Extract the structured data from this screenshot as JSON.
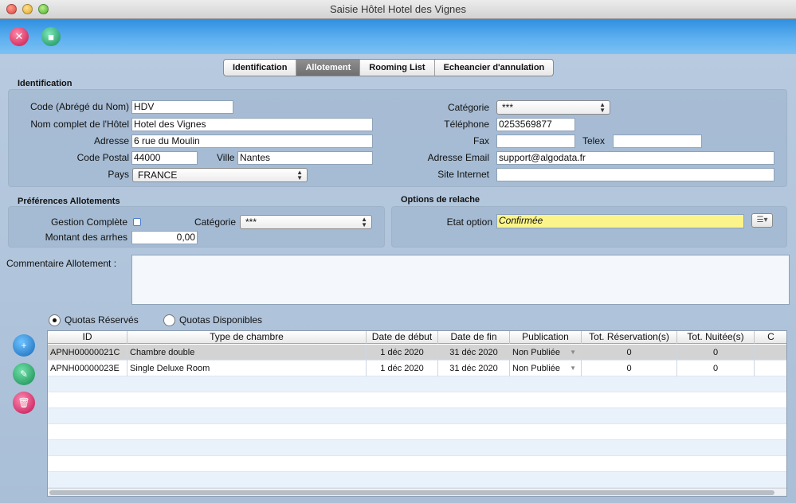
{
  "window": {
    "title": "Saisie Hôtel Hotel des Vignes"
  },
  "toolbar": {
    "close_icon": "close-doc-icon",
    "save_icon": "save-icon"
  },
  "tabs": [
    {
      "label": "Identification"
    },
    {
      "label": "Allotement",
      "active": true
    },
    {
      "label": "Rooming List"
    },
    {
      "label": "Echeancier d'annulation"
    }
  ],
  "identification": {
    "title": "Identification",
    "code_label": "Code  (Abrégé du Nom)",
    "code_value": "HDV",
    "nom_label": "Nom complet de l'Hôtel",
    "nom_value": "Hotel des Vignes",
    "adresse_label": "Adresse",
    "adresse_value": "6 rue du Moulin",
    "cp_label": "Code Postal",
    "cp_value": "44000",
    "ville_label": "Ville",
    "ville_value": "Nantes",
    "pays_label": "Pays",
    "pays_value": "FRANCE",
    "categorie_label": "Catégorie",
    "categorie_value": "***",
    "tel_label": "Téléphone",
    "tel_value": "0253569877",
    "fax_label": "Fax",
    "fax_value": "",
    "telex_label": "Telex",
    "telex_value": "",
    "email_label": "Adresse Email",
    "email_value": "support@algodata.fr",
    "site_label": "Site Internet",
    "site_value": ""
  },
  "preferences": {
    "title": "Préférences Allotements",
    "gestion_label": "Gestion Complète",
    "categorie_label": "Catégorie",
    "categorie_value": "***",
    "montant_label": "Montant des arrhes",
    "montant_value": "0,00"
  },
  "options": {
    "title": "Options de relache",
    "etat_label": "Etat option",
    "etat_value": "Confirmée"
  },
  "commentaire": {
    "label": "Commentaire Allotement :",
    "value": ""
  },
  "quotas": {
    "reserves_label": "Quotas Réservés",
    "disponibles_label": "Quotas Disponibles",
    "selected": "reserves"
  },
  "table": {
    "headers": [
      "ID",
      "Type de chambre",
      "Date de début",
      "Date de fin",
      "Publication",
      "Tot. Réservation(s)",
      "Tot. Nuitée(s)",
      "C"
    ],
    "rows": [
      {
        "id": "APNH00000021C",
        "type": "Chambre double",
        "debut": "1 déc 2020",
        "fin": "31 déc 2020",
        "publication": "Non Publiée",
        "reservations": "0",
        "nuitees": "0"
      },
      {
        "id": "APNH00000023E",
        "type": "Single Deluxe Room",
        "debut": "1 déc 2020",
        "fin": "31 déc 2020",
        "publication": "Non Publiée",
        "reservations": "0",
        "nuitees": "0"
      }
    ],
    "empty_rows": 7
  }
}
